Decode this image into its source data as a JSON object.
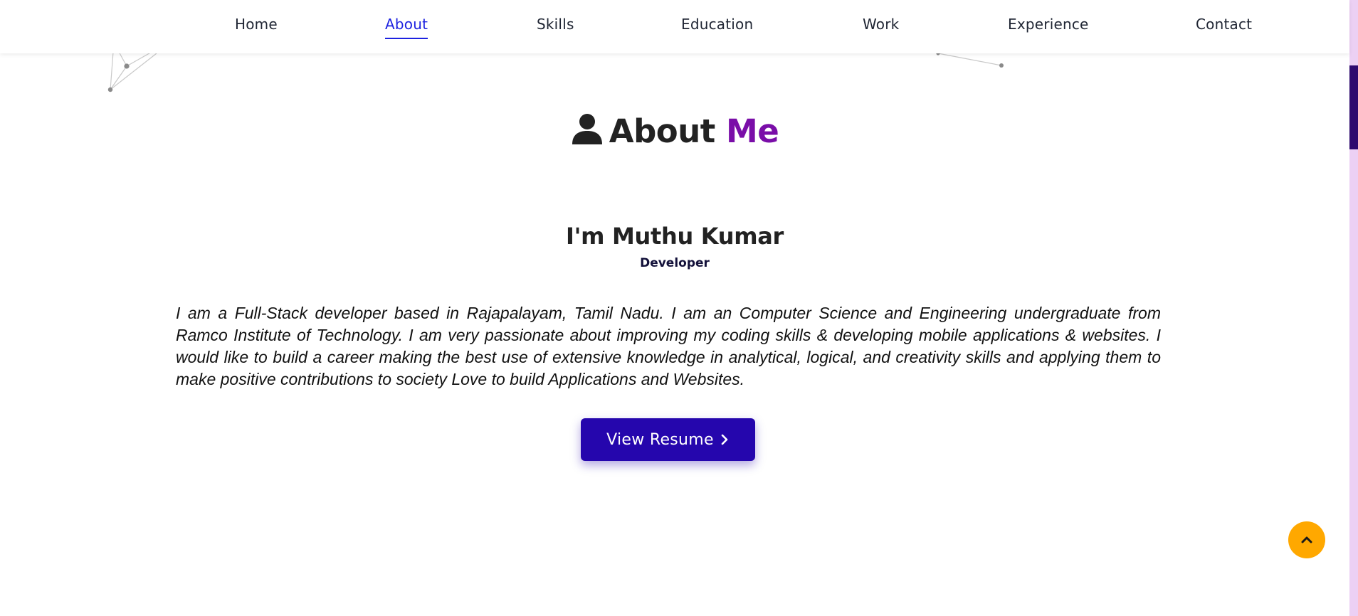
{
  "nav": {
    "items": [
      {
        "label": "Home"
      },
      {
        "label": "About",
        "active": true
      },
      {
        "label": "Skills"
      },
      {
        "label": "Education"
      },
      {
        "label": "Work"
      },
      {
        "label": "Experience"
      },
      {
        "label": "Contact"
      }
    ],
    "active_color": "#1d22e0"
  },
  "about": {
    "icon": "user-icon",
    "heading_main": "About",
    "heading_accent": "Me",
    "accent_color": "#7a0ea8",
    "name": "I'm Muthu Kumar",
    "role": "Developer",
    "bio": "I am a Full-Stack developer based in Rajapalayam, Tamil Nadu. I am an Computer Science and Engineering undergraduate from Ramco Institute of Technology. I am very passionate about improving my coding skills & developing mobile applications & websites. I would like to build a career making the best use of extensive knowledge in analytical, logical, and creativity skills and applying them to make positive contributions to society Love to build Applications and Websites.",
    "resume_button": {
      "label": "View Resume",
      "icon": "chevron-right-icon",
      "color": "#2506ad"
    }
  },
  "scroll_top": {
    "icon": "chevron-up-icon",
    "color": "#ffa800"
  },
  "scrollbar": {
    "track_color": "#ecd0f4",
    "thumb_color": "#2e0a6e"
  }
}
